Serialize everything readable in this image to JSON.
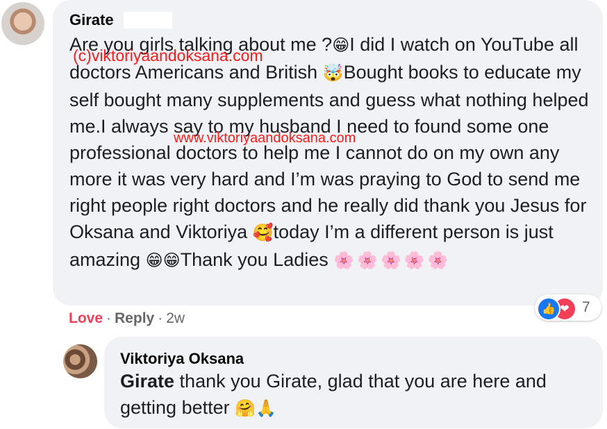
{
  "comment": {
    "author": "Girate",
    "text_segments": {
      "s1": "Are you girls talking about me ?",
      "e1": "😁",
      "s2": "I did I watch on YouTube all doctors Americans and British ",
      "e2": "🤯",
      "s3": "Bought books to educate my self bought many supplements and guess what nothing helped me.I always say to my husband I need to found some one professional doctors to help me I cannot do on my own any more it was very hard and I’m was praying to God to send me right people right doctors and he really did thank you Jesus for Oksana and Viktoriya ",
      "e3": "🥰",
      "s4": "today I’m a different person is just amazing ",
      "e4": "😁😁",
      "s5": "Thank you Ladies ",
      "e5": "🌸🌸🌸🌸🌸"
    },
    "watermark_1": "(c)viktoriyaandoksana.com",
    "watermark_2": "www.viktoriyaandoksana.com",
    "actions": {
      "love": "Love",
      "reply": "Reply",
      "time": "2w",
      "separator": "·"
    },
    "reactions": {
      "count": "7",
      "like_icon": "👍",
      "love_icon": "❤"
    }
  },
  "reply": {
    "author": "Viktoriya Oksana",
    "mention": "Girate",
    "text": " thank you Girate, glad that you are here and getting better ",
    "emoji": "🤗🙏"
  },
  "colors": {
    "bubble": "#f0f2f5",
    "love": "#f33e58",
    "like": "#1877f2",
    "watermark": "#ff1a1a",
    "meta": "#65676b"
  }
}
